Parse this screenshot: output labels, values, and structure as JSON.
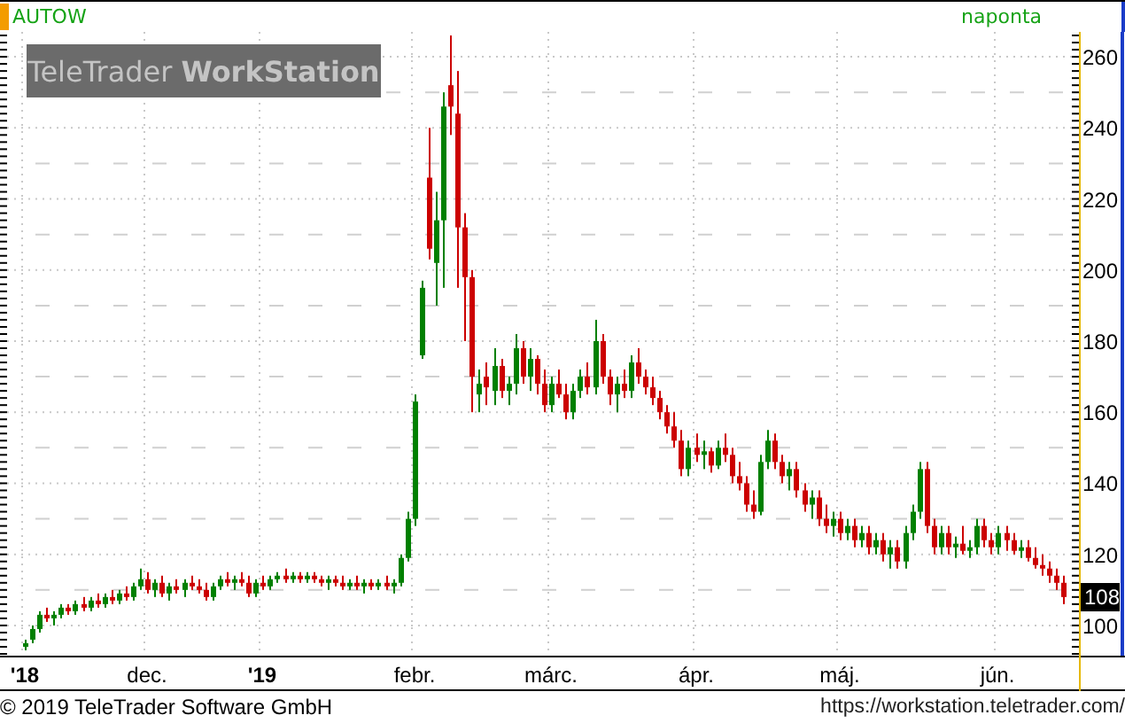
{
  "header": {
    "symbol": "AUTOW",
    "interval": "naponta"
  },
  "logo": {
    "light": "TeleTrader",
    "bold": "WorkStation"
  },
  "last_price": "108",
  "year_labels": [
    true,
    false,
    true,
    false,
    false,
    false,
    false,
    false
  ],
  "chart_data": {
    "type": "candlestick",
    "grid": true,
    "ylim": [
      92,
      268
    ],
    "yticks": [
      100,
      120,
      140,
      160,
      180,
      200,
      220,
      240,
      260
    ],
    "categories": [
      "'18",
      null,
      null,
      null,
      null,
      null,
      null,
      null,
      null,
      null,
      null,
      null,
      null,
      null,
      null,
      null,
      null,
      "dec.",
      null,
      null,
      null,
      null,
      null,
      null,
      null,
      null,
      null,
      null,
      null,
      null,
      null,
      null,
      null,
      "'19",
      null,
      null,
      null,
      null,
      null,
      null,
      null,
      null,
      null,
      null,
      null,
      null,
      null,
      null,
      null,
      null,
      null,
      null,
      null,
      null,
      "febr.",
      null,
      null,
      null,
      null,
      null,
      null,
      null,
      null,
      null,
      null,
      null,
      null,
      null,
      null,
      null,
      null,
      null,
      null,
      "márc.",
      null,
      null,
      null,
      null,
      null,
      null,
      null,
      null,
      null,
      null,
      null,
      null,
      null,
      null,
      null,
      null,
      null,
      null,
      null,
      "ápr.",
      null,
      null,
      null,
      null,
      null,
      null,
      null,
      null,
      null,
      null,
      null,
      null,
      null,
      null,
      null,
      null,
      null,
      null,
      null,
      "máj.",
      null,
      null,
      null,
      null,
      null,
      null,
      null,
      null,
      null,
      null,
      null,
      null,
      null,
      null,
      null,
      null,
      null,
      null,
      null,
      null,
      null,
      "jún.",
      null,
      null,
      null,
      null,
      null,
      null,
      null,
      null,
      null
    ],
    "ohlc": [
      [
        94,
        96,
        93,
        95
      ],
      [
        96,
        100,
        95,
        99
      ],
      [
        99,
        104,
        98,
        103
      ],
      [
        103,
        105,
        101,
        102
      ],
      [
        102,
        104,
        100,
        103
      ],
      [
        103,
        106,
        102,
        105
      ],
      [
        105,
        106,
        103,
        104
      ],
      [
        104,
        107,
        103,
        106
      ],
      [
        106,
        108,
        104,
        105
      ],
      [
        105,
        108,
        104,
        107
      ],
      [
        107,
        109,
        105,
        106
      ],
      [
        106,
        109,
        105,
        108
      ],
      [
        108,
        110,
        106,
        107
      ],
      [
        107,
        110,
        106,
        109
      ],
      [
        109,
        111,
        107,
        108
      ],
      [
        108,
        112,
        107,
        111
      ],
      [
        111,
        116,
        110,
        113
      ],
      [
        113,
        115,
        109,
        110
      ],
      [
        110,
        113,
        108,
        112
      ],
      [
        112,
        114,
        108,
        109
      ],
      [
        109,
        112,
        107,
        111
      ],
      [
        111,
        113,
        109,
        110
      ],
      [
        110,
        113,
        108,
        112
      ],
      [
        112,
        114,
        110,
        111
      ],
      [
        111,
        113,
        109,
        110
      ],
      [
        110,
        112,
        107,
        108
      ],
      [
        108,
        112,
        107,
        111
      ],
      [
        111,
        114,
        110,
        113
      ],
      [
        113,
        115,
        111,
        112
      ],
      [
        112,
        114,
        110,
        113
      ],
      [
        113,
        115,
        111,
        112
      ],
      [
        112,
        114,
        108,
        109
      ],
      [
        109,
        113,
        108,
        112
      ],
      [
        112,
        114,
        110,
        111
      ],
      [
        111,
        114,
        110,
        113
      ],
      [
        113,
        115,
        112,
        114
      ],
      [
        114,
        116,
        112,
        113
      ],
      [
        113,
        115,
        112,
        114
      ],
      [
        114,
        115,
        112,
        113
      ],
      [
        113,
        115,
        112,
        114
      ],
      [
        114,
        115,
        112,
        113
      ],
      [
        113,
        114,
        111,
        112
      ],
      [
        112,
        114,
        110,
        113
      ],
      [
        113,
        114,
        111,
        112
      ],
      [
        112,
        114,
        110,
        111
      ],
      [
        111,
        113,
        110,
        112
      ],
      [
        112,
        114,
        110,
        111
      ],
      [
        111,
        113,
        109,
        112
      ],
      [
        112,
        113,
        110,
        111
      ],
      [
        111,
        113,
        110,
        112
      ],
      [
        112,
        114,
        110,
        111
      ],
      [
        111,
        113,
        109,
        112
      ],
      [
        112,
        120,
        111,
        119
      ],
      [
        119,
        132,
        118,
        130
      ],
      [
        130,
        165,
        128,
        163
      ],
      [
        176,
        197,
        175,
        195
      ],
      [
        226,
        240,
        203,
        206
      ],
      [
        202,
        222,
        190,
        214
      ],
      [
        214,
        250,
        195,
        246
      ],
      [
        252,
        266,
        238,
        246
      ],
      [
        244,
        256,
        195,
        212
      ],
      [
        212,
        216,
        180,
        198
      ],
      [
        198,
        200,
        160,
        170
      ],
      [
        165,
        172,
        160,
        168
      ],
      [
        170,
        174,
        162,
        167
      ],
      [
        166,
        178,
        162,
        173
      ],
      [
        173,
        175,
        164,
        166
      ],
      [
        166,
        170,
        162,
        168
      ],
      [
        168,
        182,
        165,
        178
      ],
      [
        178,
        180,
        168,
        170
      ],
      [
        170,
        178,
        166,
        175
      ],
      [
        175,
        176,
        165,
        168
      ],
      [
        168,
        172,
        160,
        162
      ],
      [
        162,
        170,
        160,
        168
      ],
      [
        168,
        172,
        164,
        165
      ],
      [
        165,
        168,
        158,
        160
      ],
      [
        160,
        168,
        158,
        166
      ],
      [
        166,
        172,
        164,
        170
      ],
      [
        170,
        174,
        165,
        167
      ],
      [
        167,
        186,
        165,
        180
      ],
      [
        180,
        182,
        168,
        170
      ],
      [
        170,
        172,
        162,
        165
      ],
      [
        165,
        170,
        160,
        168
      ],
      [
        168,
        172,
        164,
        166
      ],
      [
        166,
        176,
        164,
        174
      ],
      [
        174,
        178,
        168,
        170
      ],
      [
        170,
        172,
        165,
        167
      ],
      [
        167,
        170,
        162,
        164
      ],
      [
        164,
        166,
        158,
        160
      ],
      [
        160,
        162,
        154,
        156
      ],
      [
        156,
        160,
        150,
        152
      ],
      [
        152,
        155,
        142,
        144
      ],
      [
        144,
        152,
        142,
        150
      ],
      [
        150,
        154,
        146,
        148
      ],
      [
        148,
        152,
        144,
        149
      ],
      [
        149,
        150,
        143,
        145
      ],
      [
        145,
        152,
        144,
        150
      ],
      [
        150,
        154,
        146,
        148
      ],
      [
        148,
        150,
        140,
        142
      ],
      [
        142,
        146,
        138,
        140
      ],
      [
        140,
        142,
        132,
        134
      ],
      [
        134,
        138,
        130,
        132
      ],
      [
        132,
        148,
        131,
        146
      ],
      [
        146,
        155,
        144,
        152
      ],
      [
        152,
        154,
        144,
        146
      ],
      [
        146,
        148,
        140,
        142
      ],
      [
        142,
        146,
        138,
        144
      ],
      [
        144,
        146,
        136,
        138
      ],
      [
        138,
        140,
        132,
        134
      ],
      [
        134,
        138,
        130,
        136
      ],
      [
        136,
        138,
        128,
        130
      ],
      [
        130,
        134,
        126,
        128
      ],
      [
        128,
        132,
        125,
        130
      ],
      [
        130,
        132,
        124,
        126
      ],
      [
        126,
        130,
        124,
        128
      ],
      [
        128,
        130,
        122,
        124
      ],
      [
        124,
        128,
        122,
        126
      ],
      [
        126,
        128,
        120,
        122
      ],
      [
        122,
        126,
        120,
        124
      ],
      [
        124,
        126,
        118,
        120
      ],
      [
        120,
        124,
        116,
        122
      ],
      [
        122,
        124,
        116,
        118
      ],
      [
        118,
        128,
        116,
        126
      ],
      [
        126,
        134,
        124,
        132
      ],
      [
        132,
        146,
        130,
        144
      ],
      [
        144,
        146,
        126,
        128
      ],
      [
        128,
        130,
        120,
        122
      ],
      [
        122,
        128,
        120,
        126
      ],
      [
        126,
        128,
        120,
        122
      ],
      [
        122,
        125,
        119,
        123
      ],
      [
        123,
        128,
        120,
        121
      ],
      [
        121,
        124,
        119,
        122
      ],
      [
        122,
        130,
        120,
        128
      ],
      [
        128,
        130,
        122,
        124
      ],
      [
        124,
        126,
        120,
        122
      ],
      [
        122,
        128,
        120,
        126
      ],
      [
        126,
        128,
        121,
        124
      ],
      [
        124,
        126,
        120,
        121
      ],
      [
        121,
        124,
        119,
        122
      ],
      [
        122,
        124,
        118,
        119
      ],
      [
        119,
        122,
        116,
        117
      ],
      [
        117,
        120,
        114,
        116
      ],
      [
        116,
        118,
        112,
        114
      ],
      [
        114,
        116,
        110,
        112
      ],
      [
        112,
        114,
        106,
        108
      ]
    ]
  },
  "footer": {
    "copyright": "© 2019 TeleTrader Software GmbH",
    "url": "https://workstation.teletrader.com/"
  }
}
